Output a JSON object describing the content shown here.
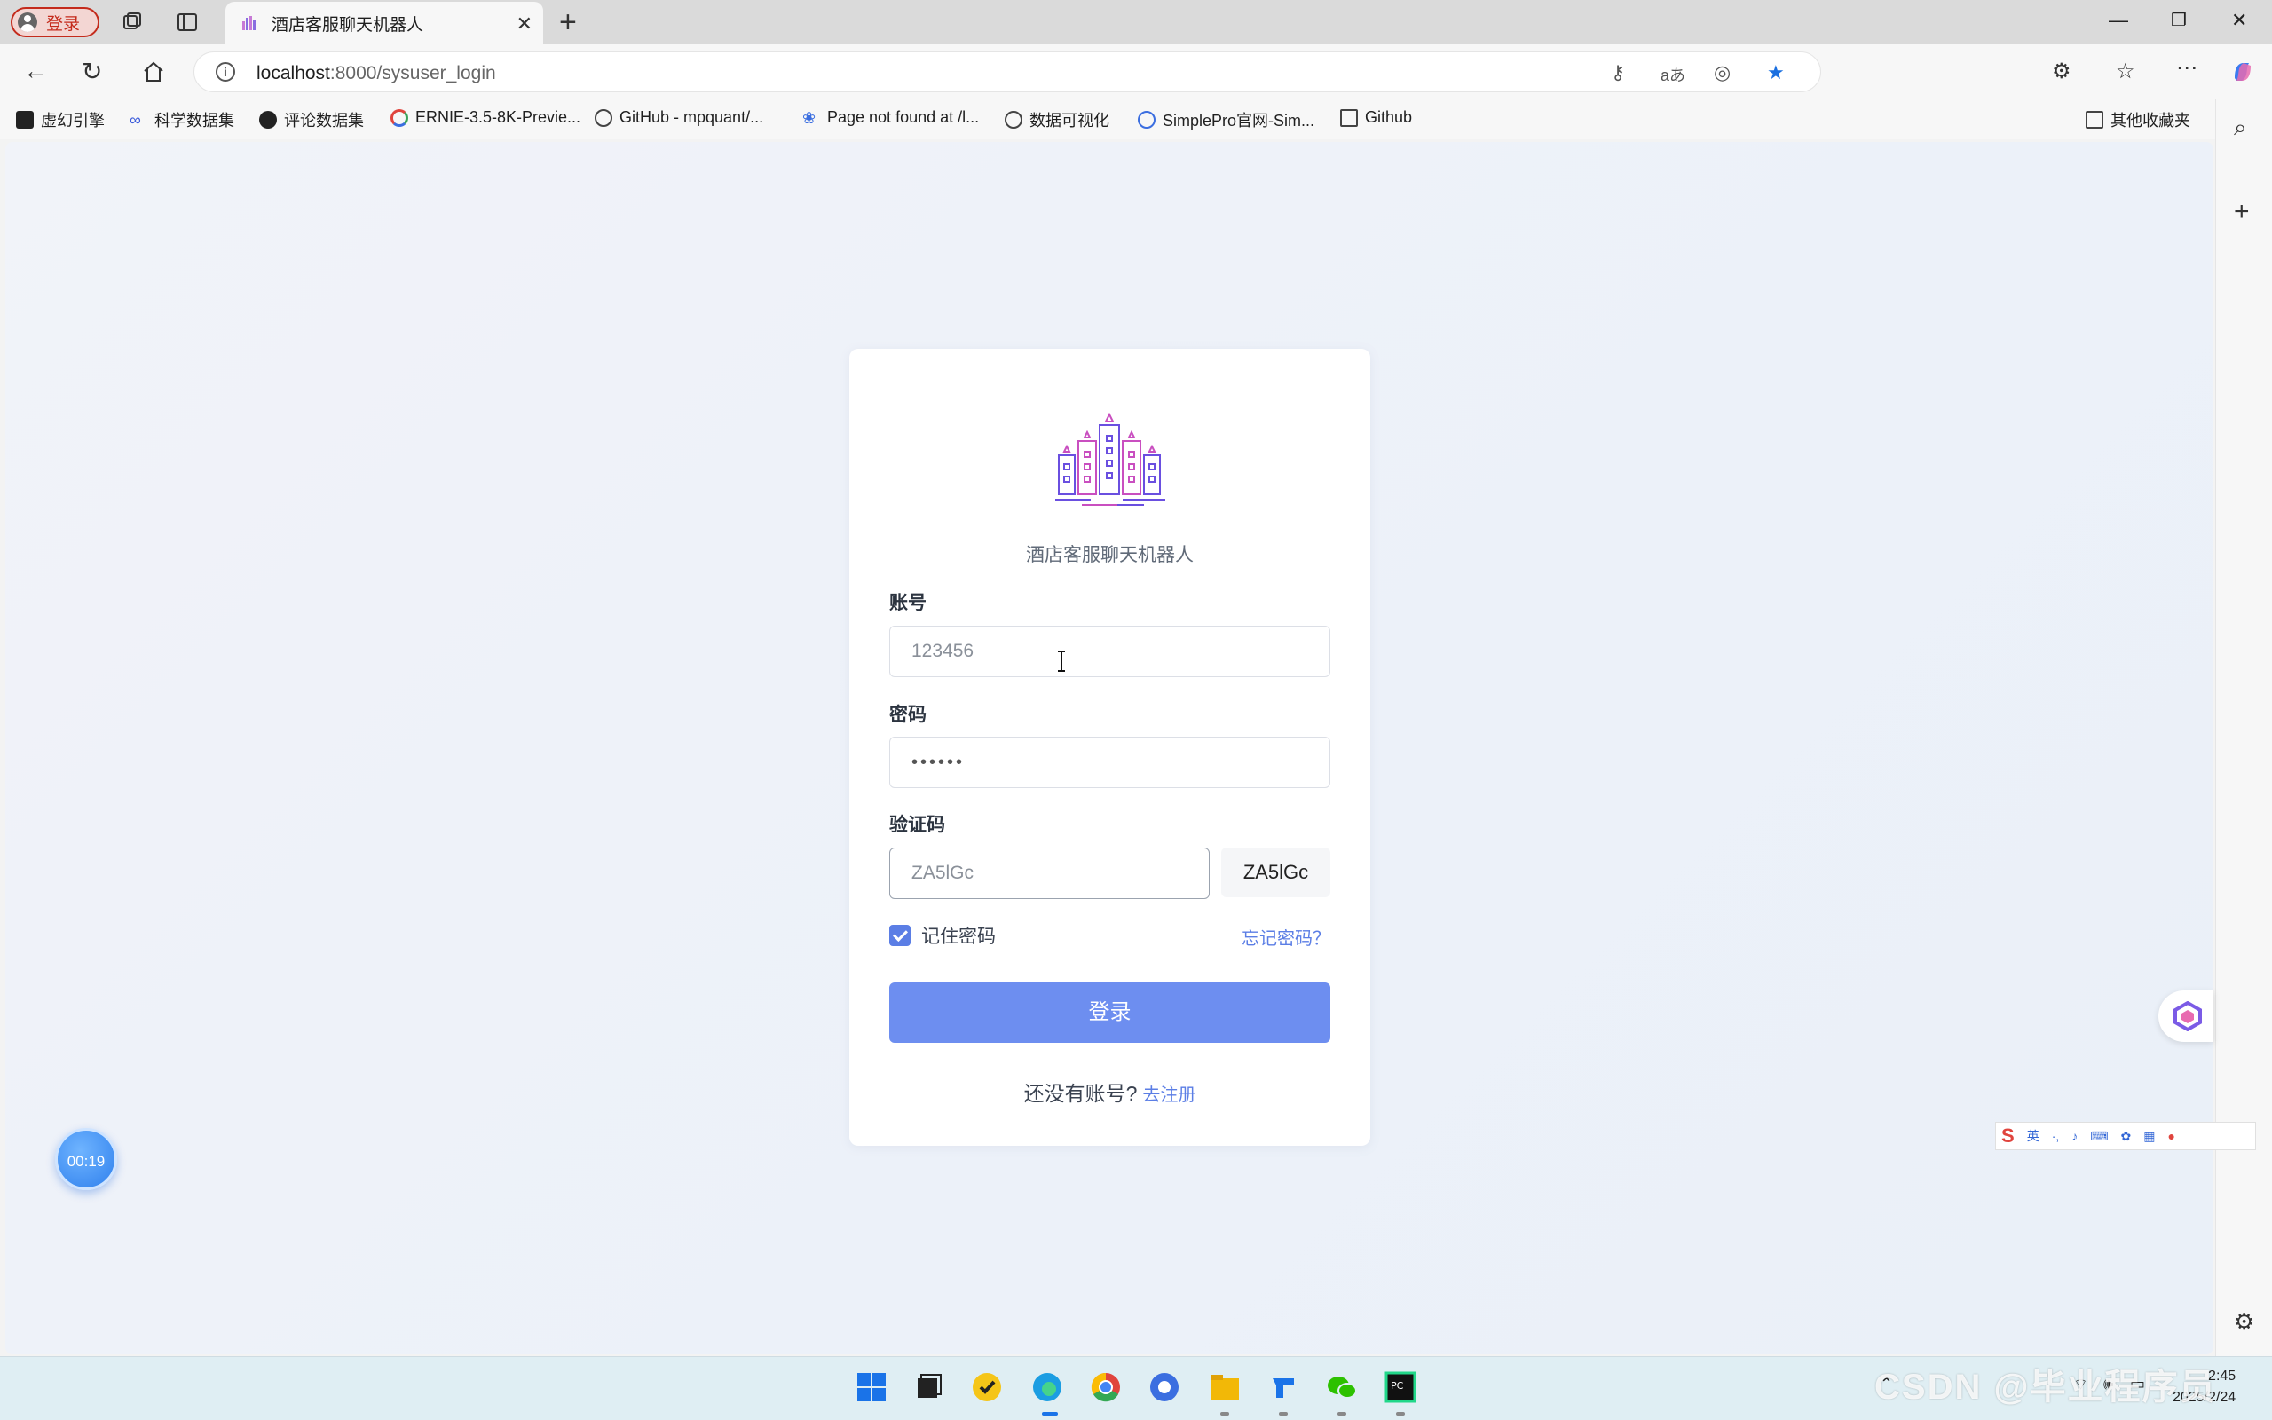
{
  "browser": {
    "profile_label": "登录",
    "tab_title": "酒店客服聊天机器人",
    "url_host": "localhost",
    "url_path": ":8000/sysuser_login"
  },
  "bookmarks": [
    {
      "label": "虚幻引擎",
      "icon": "epic-icon"
    },
    {
      "label": "科学数据集",
      "icon": "infinity-icon"
    },
    {
      "label": "评论数据集",
      "icon": "github-icon"
    },
    {
      "label": "ERNIE-3.5-8K-Previe...",
      "icon": "ernie-icon"
    },
    {
      "label": "GitHub - mpquant/...",
      "icon": "globe-icon"
    },
    {
      "label": "Page not found at /l...",
      "icon": "paw-icon"
    },
    {
      "label": "数据可视化",
      "icon": "globe-icon"
    },
    {
      "label": "SimplePro官网-Sim...",
      "icon": "simplepro-icon"
    },
    {
      "label": "Github",
      "icon": "folder-icon"
    }
  ],
  "bookmarks_other": "其他收藏夹",
  "login": {
    "app_title": "酒店客服聊天机器人",
    "account_label": "账号",
    "account_value": "123456",
    "password_label": "密码",
    "password_value": "••••••",
    "captcha_label": "验证码",
    "captcha_input_value": "ZA5lGc",
    "captcha_image_text": "ZA5lGc",
    "remember_label": "记住密码",
    "remember_checked": true,
    "forgot_label": "忘记密码？",
    "login_button": "登录",
    "no_account_text": "还没有账号?",
    "register_link": "去注册"
  },
  "timer": "00:19",
  "ime": {
    "mode": "英"
  },
  "taskbar": {
    "time": "2:45",
    "date": "2025/2/24"
  },
  "watermark": "CSDN @毕业程序员",
  "colors": {
    "accent": "#6d8ef0",
    "link": "#5b7ee5"
  }
}
